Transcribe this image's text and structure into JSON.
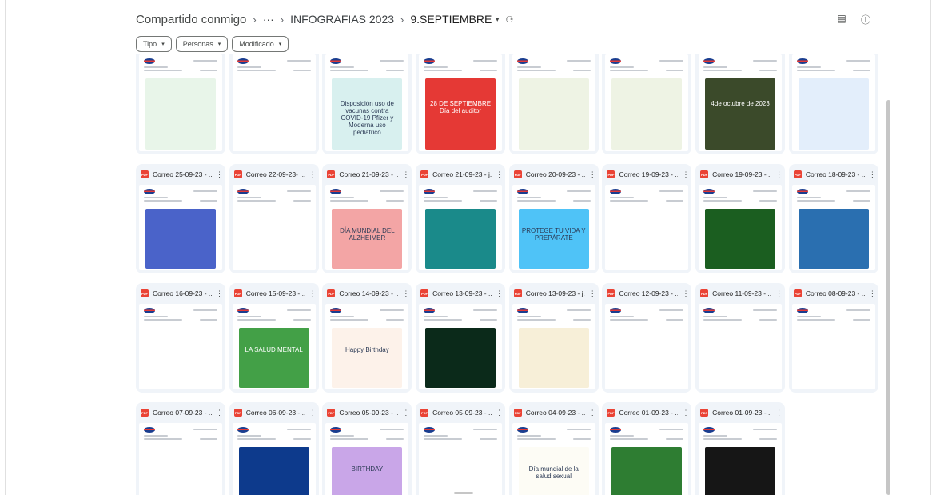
{
  "breadcrumb": {
    "root": "Compartido conmigo",
    "ellipsis": "···",
    "folder": "INFOGRAFIAS 2023",
    "current": "9.SEPTIEMBRE"
  },
  "filters": [
    {
      "label": "Tipo"
    },
    {
      "label": "Personas"
    },
    {
      "label": "Modificado"
    }
  ],
  "icons": {
    "pdf": "PDF",
    "more": "⋮",
    "chevron": "▾",
    "separator": "›",
    "people": "⚇",
    "info": "ⓘ",
    "details": "▤"
  },
  "rows": [
    [
      {
        "name": "",
        "poster": "green-steps",
        "color": "#e8f5e9"
      },
      {
        "name": "",
        "poster": "text-list",
        "color": ""
      },
      {
        "name": "",
        "poster": "vaccine",
        "color": "#d8f0ef",
        "text": "Disposición uso de vacunas contra COVID-19 Pfizer y Moderna uso pediátrico"
      },
      {
        "name": "",
        "poster": "auditor",
        "color": "#e53935",
        "text": "28 DE SEPTIEMBRE Día del auditor"
      },
      {
        "name": "",
        "poster": "road",
        "color": "#eef3e4"
      },
      {
        "name": "",
        "poster": "road",
        "color": "#eef3e4"
      },
      {
        "name": "",
        "poster": "evacuation",
        "color": "#3b4a2a",
        "text": "4de octubre de 2023"
      },
      {
        "name": "",
        "poster": "sura",
        "color": "#e3eefb"
      }
    ],
    [
      {
        "name": "Correo 25-09-23 - ...",
        "poster": "pharma",
        "color": "#4a63c9"
      },
      {
        "name": "Correo 22-09-23- ...",
        "poster": "blank",
        "color": ""
      },
      {
        "name": "Correo 21-09-23 - ...",
        "poster": "alzheimer",
        "color": "#f3a5a5",
        "text": "DÍA MUNDIAL DEL ALZHEIMER"
      },
      {
        "name": "Correo 21-09-23 - j...",
        "poster": "birthday-teal",
        "color": "#1a8a8a"
      },
      {
        "name": "Correo 20-09-23 - ...",
        "poster": "protege",
        "color": "#4fc3f7",
        "text": "PROTEGE TU VIDA Y PREPÁRATE"
      },
      {
        "name": "Correo 19-09-23 - ...",
        "poster": "blank",
        "color": ""
      },
      {
        "name": "Correo 19-09-23 - ...",
        "poster": "rehab",
        "color": "#1b5e20"
      },
      {
        "name": "Correo 18-09-23 - ...",
        "poster": "car",
        "color": "#2a6fb0"
      }
    ],
    [
      {
        "name": "Correo 16-09-23 - ...",
        "poster": "blank",
        "color": ""
      },
      {
        "name": "Correo 15-09-23 - ...",
        "poster": "salud-mental",
        "color": "#43a047",
        "text": "LA SALUD MENTAL"
      },
      {
        "name": "Correo 14-09-23 - ...",
        "poster": "happy",
        "color": "#fdf2ea",
        "text": "Happy Birthday"
      },
      {
        "name": "Correo 13-09-23 - ...",
        "poster": "programador",
        "color": "#0b2a1a"
      },
      {
        "name": "Correo 13-09-23 - j...",
        "poster": "cumpleanos",
        "color": "#f7efd8"
      },
      {
        "name": "Correo 12-09-23 - ...",
        "poster": "suicide",
        "color": "#ffffff"
      },
      {
        "name": "Correo 11-09-23 - ...",
        "poster": "blank",
        "color": ""
      },
      {
        "name": "Correo 08-09-23 - ...",
        "poster": "signs",
        "color": "#ffffff"
      }
    ],
    [
      {
        "name": "Correo 07-09-23 - ...",
        "poster": "blank",
        "color": ""
      },
      {
        "name": "Correo 06-09-23 - ...",
        "poster": "dark-blue",
        "color": "#0d3a8c"
      },
      {
        "name": "Correo 05-09-23 - ...",
        "poster": "birthday-purple",
        "color": "#c9a6e8",
        "text": "BIRTHDAY"
      },
      {
        "name": "Correo 05-09-23 - ...",
        "poster": "blank",
        "color": ""
      },
      {
        "name": "Correo 04-09-23 - ...",
        "poster": "sexual",
        "color": "#fdfcf5",
        "text": "Día mundial de la salud sexual"
      },
      {
        "name": "Correo 01-09-23 - ...",
        "poster": "steps-green",
        "color": "#2e7d32"
      },
      {
        "name": "Correo 01-09-23 - ...",
        "poster": "black",
        "color": "#161616"
      }
    ]
  ]
}
